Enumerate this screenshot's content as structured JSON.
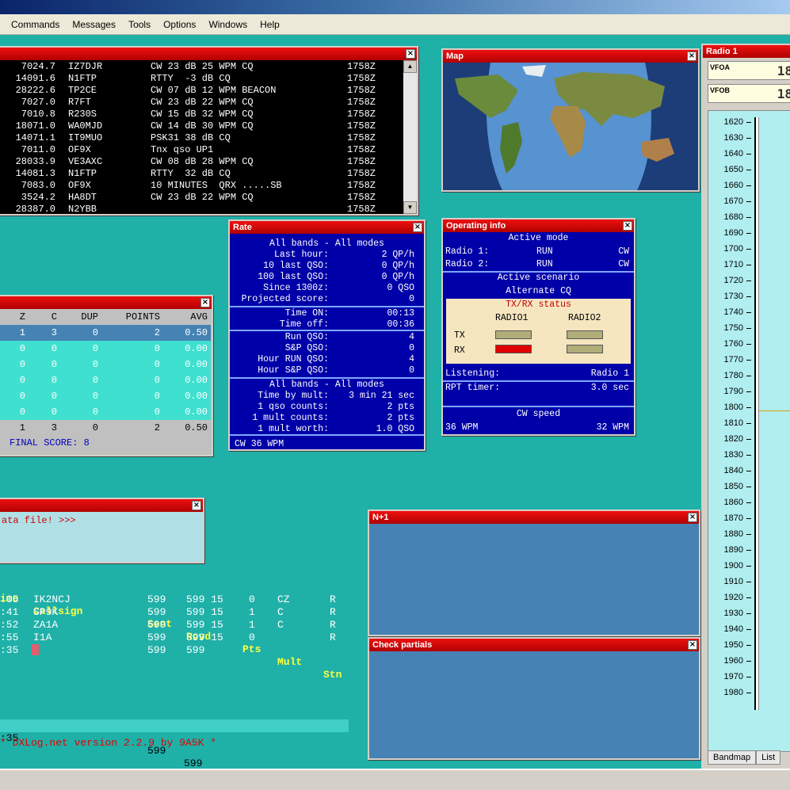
{
  "menu": [
    "Commands",
    "Messages",
    "Tools",
    "Options",
    "Windows",
    "Help"
  ],
  "cluster": {
    "rows": [
      {
        "freq": "7024.7",
        "call": "IZ7DJR",
        "info": "CW 23 dB 25 WPM CQ",
        "time": "1758Z"
      },
      {
        "freq": "14091.6",
        "call": "N1FTP",
        "info": "RTTY  -3 dB CQ",
        "time": "1758Z"
      },
      {
        "freq": "28222.6",
        "call": "TP2CE",
        "info": "CW 07 dB 12 WPM BEACON",
        "time": "1758Z"
      },
      {
        "freq": "7027.0",
        "call": "R7FT",
        "info": "CW 23 dB 22 WPM CQ",
        "time": "1758Z"
      },
      {
        "freq": "7010.8",
        "call": "R230S",
        "info": "CW 15 dB 32 WPM CQ",
        "time": "1758Z"
      },
      {
        "freq": "18071.0",
        "call": "WA0MJD",
        "info": "CW 14 dB 30 WPM CQ",
        "time": "1758Z"
      },
      {
        "freq": "14071.1",
        "call": "IT9MUO",
        "info": "PSK31 38 dB CQ",
        "time": "1758Z"
      },
      {
        "freq": "7011.0",
        "call": "OF9X",
        "info": "Tnx qso UP1",
        "time": "1758Z"
      },
      {
        "freq": "28033.9",
        "call": "VE3AXC",
        "info": "CW 08 dB 28 WPM CQ",
        "time": "1758Z"
      },
      {
        "freq": "14081.3",
        "call": "N1FTP",
        "info": "RTTY  32 dB CQ",
        "time": "1758Z"
      },
      {
        "freq": "7083.0",
        "call": "OF9X",
        "info": "10 MINUTES  QRX .....SB",
        "time": "1758Z"
      },
      {
        "freq": "3524.2",
        "call": "HA8DT",
        "info": "CW 23 dB 22 WPM CQ",
        "time": "1758Z"
      },
      {
        "freq": "28387.0",
        "call": "N2YBB",
        "info": "",
        "time": "1758Z"
      }
    ]
  },
  "map": {
    "title": "Map"
  },
  "rate": {
    "title": "Rate",
    "sec1": [
      {
        "k": "",
        "v": "All bands - All modes",
        "center": true
      },
      {
        "k": "Last hour:",
        "v": "2 QP/h"
      },
      {
        "k": "10 last QSO:",
        "v": "0 QP/h"
      },
      {
        "k": "100 last QSO:",
        "v": "0 QP/h"
      },
      {
        "k": "Since 1300z:",
        "v": "0 QSO"
      },
      {
        "k": "Projected score:",
        "v": "0"
      }
    ],
    "sec2": [
      {
        "k": "Time ON:",
        "v": "00:13"
      },
      {
        "k": "Time off:",
        "v": "00:36"
      }
    ],
    "sec3": [
      {
        "k": "Run QSO:",
        "v": "4"
      },
      {
        "k": "S&P QSO:",
        "v": "0"
      },
      {
        "k": "Hour RUN QSO:",
        "v": "4"
      },
      {
        "k": "Hour S&P QSO:",
        "v": "0"
      }
    ],
    "sec4": [
      {
        "k": "",
        "v": "All bands - All modes",
        "center": true
      },
      {
        "k": "Time by mult:",
        "v": "3 min 21 sec"
      },
      {
        "k": "1 qso counts:",
        "v": "2 pts"
      },
      {
        "k": "1 mult counts:",
        "v": "2 pts"
      },
      {
        "k": "1 mult worth:",
        "v": "1.0 QSO"
      }
    ],
    "footer": "CW 36 WPM"
  },
  "opinfo": {
    "title": "Operating info",
    "active_mode": "Active mode",
    "radio1_label": "Radio 1:",
    "radio1_mode": "RUN",
    "radio1_op": "CW",
    "radio2_label": "Radio 2:",
    "radio2_mode": "RUN",
    "radio2_op": "CW",
    "active_scenario": "Active scenario",
    "scenario": "Alternate CQ",
    "txrx_title": "TX/RX status",
    "col1": "RADIO1",
    "col2": "RADIO2",
    "tx": "TX",
    "rx": "RX",
    "listening_label": "Listening:",
    "listening_value": "Radio 1",
    "rpt_label": "RPT timer:",
    "rpt_value": "3.0 sec",
    "cw_speed": "CW speed",
    "cw_left": "36 WPM",
    "cw_right": "32 WPM"
  },
  "score": {
    "headers": [
      "Z",
      "C",
      "DUP",
      "POINTS",
      "AVG"
    ],
    "rows": [
      [
        "1",
        "3",
        "0",
        "2",
        "0.50"
      ],
      [
        "0",
        "0",
        "0",
        "0",
        "0.00"
      ],
      [
        "0",
        "0",
        "0",
        "0",
        "0.00"
      ],
      [
        "0",
        "0",
        "0",
        "0",
        "0.00"
      ],
      [
        "0",
        "0",
        "0",
        "0",
        "0.00"
      ],
      [
        "0",
        "0",
        "0",
        "0",
        "0.00"
      ]
    ],
    "total": [
      "1",
      "3",
      "0",
      "2",
      "0.50"
    ],
    "final": "FINAL SCORE:  8"
  },
  "message": {
    "text": "ata file! >>>"
  },
  "log": {
    "headers": {
      "time": "ime",
      "call": "Callsign",
      "sent": "Sent",
      "rcvd": "Rcvd",
      "pts": "Pts",
      "mult": "Mult",
      "stn": "Stn"
    },
    "rows": [
      {
        "time": ":05",
        "call": "IK2NCJ",
        "sent": "599",
        "rcvd": "599 15",
        "pts": "0",
        "mult": "CZ",
        "stn": "R"
      },
      {
        "time": ":41",
        "call": "SP9K",
        "sent": "599",
        "rcvd": "599 15",
        "pts": "1",
        "mult": "C",
        "stn": "R"
      },
      {
        "time": ":52",
        "call": "ZA1A",
        "sent": "599",
        "rcvd": "599 15",
        "pts": "1",
        "mult": "C",
        "stn": "R"
      },
      {
        "time": ":55",
        "call": "I1A",
        "sent": "599",
        "rcvd": "599 15",
        "pts": "0",
        "mult": "",
        "stn": "R"
      },
      {
        "time": ":35",
        "call": "",
        "sent": "599",
        "rcvd": "599",
        "pts": "",
        "mult": "",
        "stn": ""
      }
    ],
    "entry": {
      "time": ":35",
      "sent": "599",
      "rcvd": "599"
    },
    "version": "* DXLog.net version 2.2.9 by 9A5K *"
  },
  "nplus1": {
    "title": "N+1"
  },
  "partials": {
    "title": "Check partials"
  },
  "radio": {
    "title": "Radio 1",
    "vfoa": "VFOA",
    "vfob": "VFOB",
    "vfo_digits": "18",
    "freqs": [
      "1620",
      "1630",
      "1640",
      "1650",
      "1660",
      "1670",
      "1680",
      "1690",
      "1700",
      "1710",
      "1720",
      "1730",
      "1740",
      "1750",
      "1760",
      "1770",
      "1780",
      "1790",
      "1800",
      "1810",
      "1820",
      "1830",
      "1840",
      "1850",
      "1860",
      "1870",
      "1880",
      "1890",
      "1900",
      "1910",
      "1920",
      "1930",
      "1940",
      "1950",
      "1960",
      "1970",
      "1980"
    ],
    "tabs": [
      "Bandmap",
      "List"
    ]
  },
  "colors": {
    "bg": "#1fb0a8",
    "title_red": "#c00000",
    "panel_blue": "#0000a8",
    "log_yellow": "#ffff40",
    "version_red": "#e00000"
  }
}
